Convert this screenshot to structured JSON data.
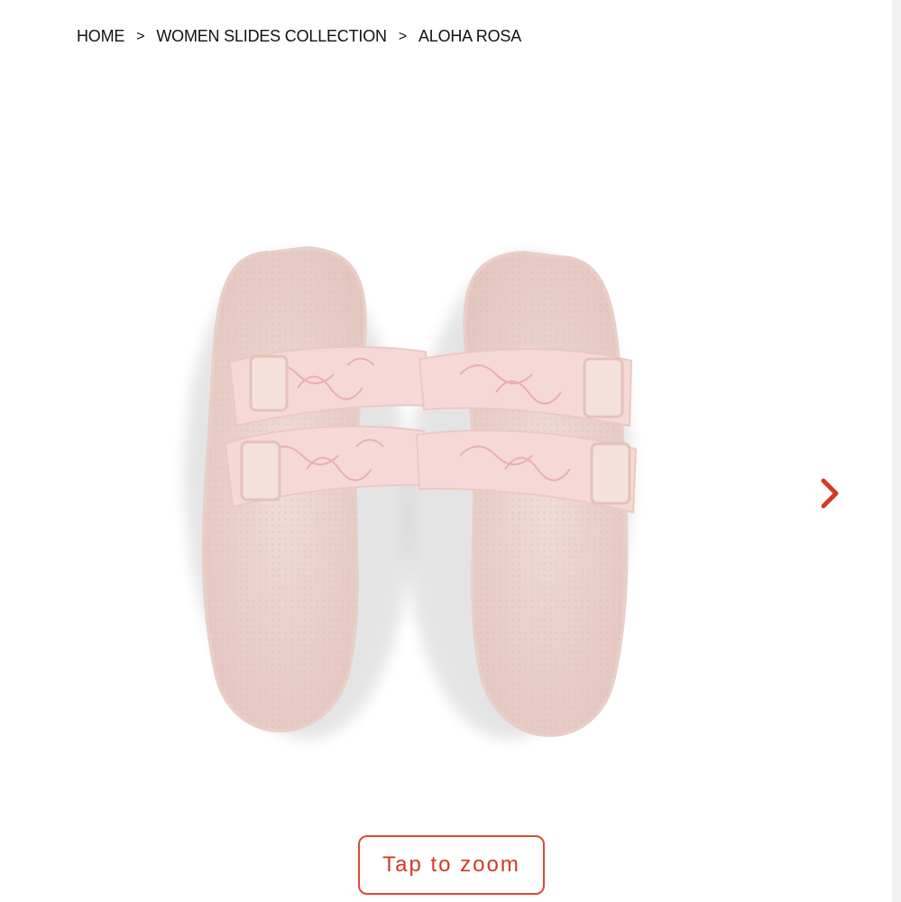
{
  "breadcrumb": {
    "items": [
      "HOME",
      "WOMEN SLIDES COLLECTION",
      "ALOHA ROSA"
    ],
    "separator": ">"
  },
  "gallery": {
    "image": "pink-floral-slide-sandals",
    "next_icon": "chevron-right-icon"
  },
  "zoom": {
    "label": "Tap to zoom"
  },
  "colors": {
    "accent": "#d94a36",
    "sandal_base": "#f1d3cf",
    "text": "#111111"
  }
}
